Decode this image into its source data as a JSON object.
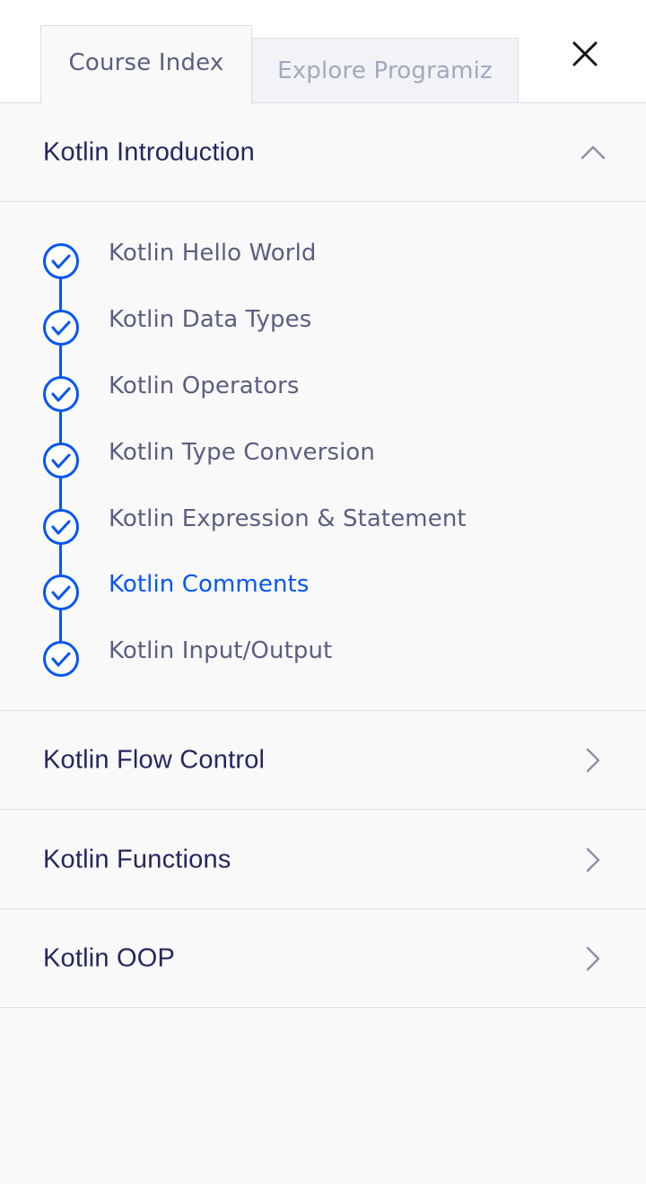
{
  "tabs": [
    {
      "label": "Course Index",
      "active": true
    },
    {
      "label": "Explore Programiz",
      "active": false
    }
  ],
  "close_icon": "close-icon",
  "sections": [
    {
      "title": "Kotlin Introduction",
      "expanded": true,
      "chevron": "chevron-up-icon",
      "lessons": [
        {
          "label": "Kotlin Hello World",
          "completed": true,
          "current": false
        },
        {
          "label": "Kotlin Data Types",
          "completed": true,
          "current": false
        },
        {
          "label": "Kotlin Operators",
          "completed": true,
          "current": false
        },
        {
          "label": "Kotlin Type Conversion",
          "completed": true,
          "current": false
        },
        {
          "label": "Kotlin Expression & Statement",
          "completed": true,
          "current": false
        },
        {
          "label": "Kotlin Comments",
          "completed": true,
          "current": true
        },
        {
          "label": "Kotlin Input/Output",
          "completed": true,
          "current": false
        }
      ]
    },
    {
      "title": "Kotlin Flow Control",
      "expanded": false,
      "chevron": "chevron-right-icon"
    },
    {
      "title": "Kotlin Functions",
      "expanded": false,
      "chevron": "chevron-right-icon"
    },
    {
      "title": "Kotlin OOP",
      "expanded": false,
      "chevron": "chevron-right-icon"
    }
  ],
  "colors": {
    "accent": "#0556f3",
    "heading": "#25265e",
    "text": "#5b5e80",
    "muted": "#a4a7bf",
    "background": "#f9f9fa",
    "border": "#dcdde6"
  }
}
